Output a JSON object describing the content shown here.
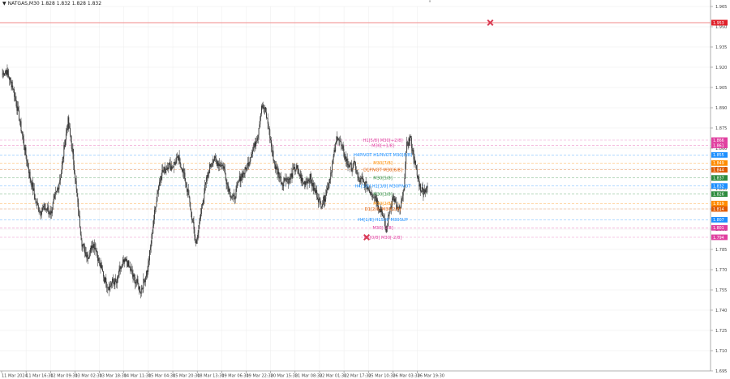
{
  "header": {
    "symbol_line": "NATGAS,M30  1.828 1.832 1.828 1.832"
  },
  "colors": {
    "background": "#ffffff",
    "candle": "#333333",
    "grid": "#ececec",
    "resistance_line": "#f08a8a",
    "resistance_badge": "#e0202a",
    "marker": "#d93a52"
  },
  "chart_data": {
    "type": "candlestick",
    "symbol": "NATGAS",
    "timeframe": "M30",
    "ylim": [
      1.695,
      1.965
    ],
    "y_ticks": [
      "1.965",
      "1.950",
      "1.935",
      "1.920",
      "1.905",
      "1.890",
      "1.875",
      "1.860",
      "1.845",
      "1.830",
      "1.815",
      "1.800",
      "1.785",
      "1.770",
      "1.755",
      "1.740",
      "1.725",
      "1.710",
      "1.695"
    ],
    "x_ticks": [
      "11 Mar 2024",
      "11 Mar 16:30",
      "12 Mar 09:30",
      "13 Mar 02:30",
      "13 Mar 18:30",
      "14 Mar 11:30",
      "15 Mar 04:30",
      "15 Mar 20:30",
      "18 Mar 13:30",
      "19 Mar 06:30",
      "19 Mar 22:30",
      "20 Mar 15:30",
      "21 Mar 08:30",
      "22 Mar 01:30",
      "22 Mar 17:30",
      "25 Mar 10:30",
      "26 Mar 03:30",
      "26 Mar 19:30"
    ],
    "close_path": [
      1.915,
      1.918,
      1.912,
      1.905,
      1.893,
      1.88,
      1.866,
      1.852,
      1.838,
      1.828,
      1.818,
      1.813,
      1.816,
      1.814,
      1.812,
      1.822,
      1.83,
      1.842,
      1.864,
      1.88,
      1.862,
      1.84,
      1.812,
      1.79,
      1.783,
      1.78,
      1.79,
      1.786,
      1.775,
      1.768,
      1.76,
      1.757,
      1.762,
      1.76,
      1.77,
      1.775,
      1.776,
      1.77,
      1.764,
      1.76,
      1.754,
      1.762,
      1.77,
      1.79,
      1.812,
      1.83,
      1.842,
      1.844,
      1.848,
      1.846,
      1.85,
      1.852,
      1.845,
      1.835,
      1.822,
      1.806,
      1.789,
      1.804,
      1.822,
      1.836,
      1.846,
      1.852,
      1.85,
      1.848,
      1.846,
      1.834,
      1.826,
      1.822,
      1.832,
      1.84,
      1.842,
      1.848,
      1.856,
      1.862,
      1.872,
      1.892,
      1.888,
      1.876,
      1.858,
      1.846,
      1.84,
      1.834,
      1.838,
      1.836,
      1.842,
      1.846,
      1.84,
      1.834,
      1.836,
      1.838,
      1.83,
      1.826,
      1.818,
      1.822,
      1.83,
      1.842,
      1.856,
      1.87,
      1.862,
      1.854,
      1.848,
      1.846,
      1.848,
      1.836,
      1.836,
      1.833,
      1.83,
      1.826,
      1.824,
      1.816,
      1.812,
      1.798,
      1.814,
      1.824,
      1.816,
      1.814,
      1.826,
      1.862,
      1.868,
      1.854,
      1.84,
      1.83,
      1.828,
      1.832
    ],
    "levels": [
      {
        "label": "H1[5/8] M30[+2/8]",
        "value": 1.866,
        "color": "#e040a0",
        "badge": "1.866",
        "style": "dash"
      },
      {
        "label": "M30[+1/8]",
        "value": 1.862,
        "color": "#e040a0",
        "badge": "1.861",
        "style": "dash"
      },
      {
        "label": "H4PIVOT H1PIVOT M30[8/8]",
        "value": 1.855,
        "color": "#1e90ff",
        "badge": "1.855",
        "style": "dash"
      },
      {
        "label": "M30[7/8]",
        "value": 1.849,
        "color": "#ff8c00",
        "badge": "1.849",
        "style": "dash"
      },
      {
        "label": "D1PIVOT M30[6/8]",
        "value": 1.844,
        "color": "#e05a00",
        "badge": "1.844",
        "style": "dash"
      },
      {
        "label": "M30[5/8]",
        "value": 1.838,
        "color": "#2e8b3e",
        "badge": "1.837",
        "style": "dash"
      },
      {
        "label": "H4[3/8] H1[3/8] M30PIVOT",
        "value": 1.832,
        "color": "#1e90ff",
        "badge": "1.832",
        "style": "dash"
      },
      {
        "label": "M30[3/8]",
        "value": 1.826,
        "color": "#2e8b3e",
        "badge": "1.826",
        "style": "dash"
      },
      {
        "label": "M30[2/8]",
        "value": 1.819,
        "color": "#ff8c00",
        "badge": "1.819",
        "style": "dash"
      },
      {
        "label": "D1[2/8] M30[2/8]",
        "value": 1.815,
        "color": "#e05a00",
        "badge": "1.814",
        "style": "dash"
      },
      {
        "label": "H4[1/8] H1SUP M30SUP",
        "value": 1.807,
        "color": "#1e90ff",
        "badge": "1.807",
        "style": "dash"
      },
      {
        "label": "M30[-1/8]",
        "value": 1.801,
        "color": "#e040a0",
        "badge": "1.801",
        "style": "dash"
      },
      {
        "label": "H1[0/8] M30[-2/8]",
        "value": 1.794,
        "color": "#e040a0",
        "badge": "1.794",
        "style": "dash"
      }
    ],
    "resistance": {
      "value": 1.953,
      "badge": "1.953"
    },
    "markers": [
      {
        "x_frac": 0.69,
        "value": 1.953
      },
      {
        "x_frac": 0.516,
        "value": 1.794
      }
    ],
    "grid": true
  }
}
